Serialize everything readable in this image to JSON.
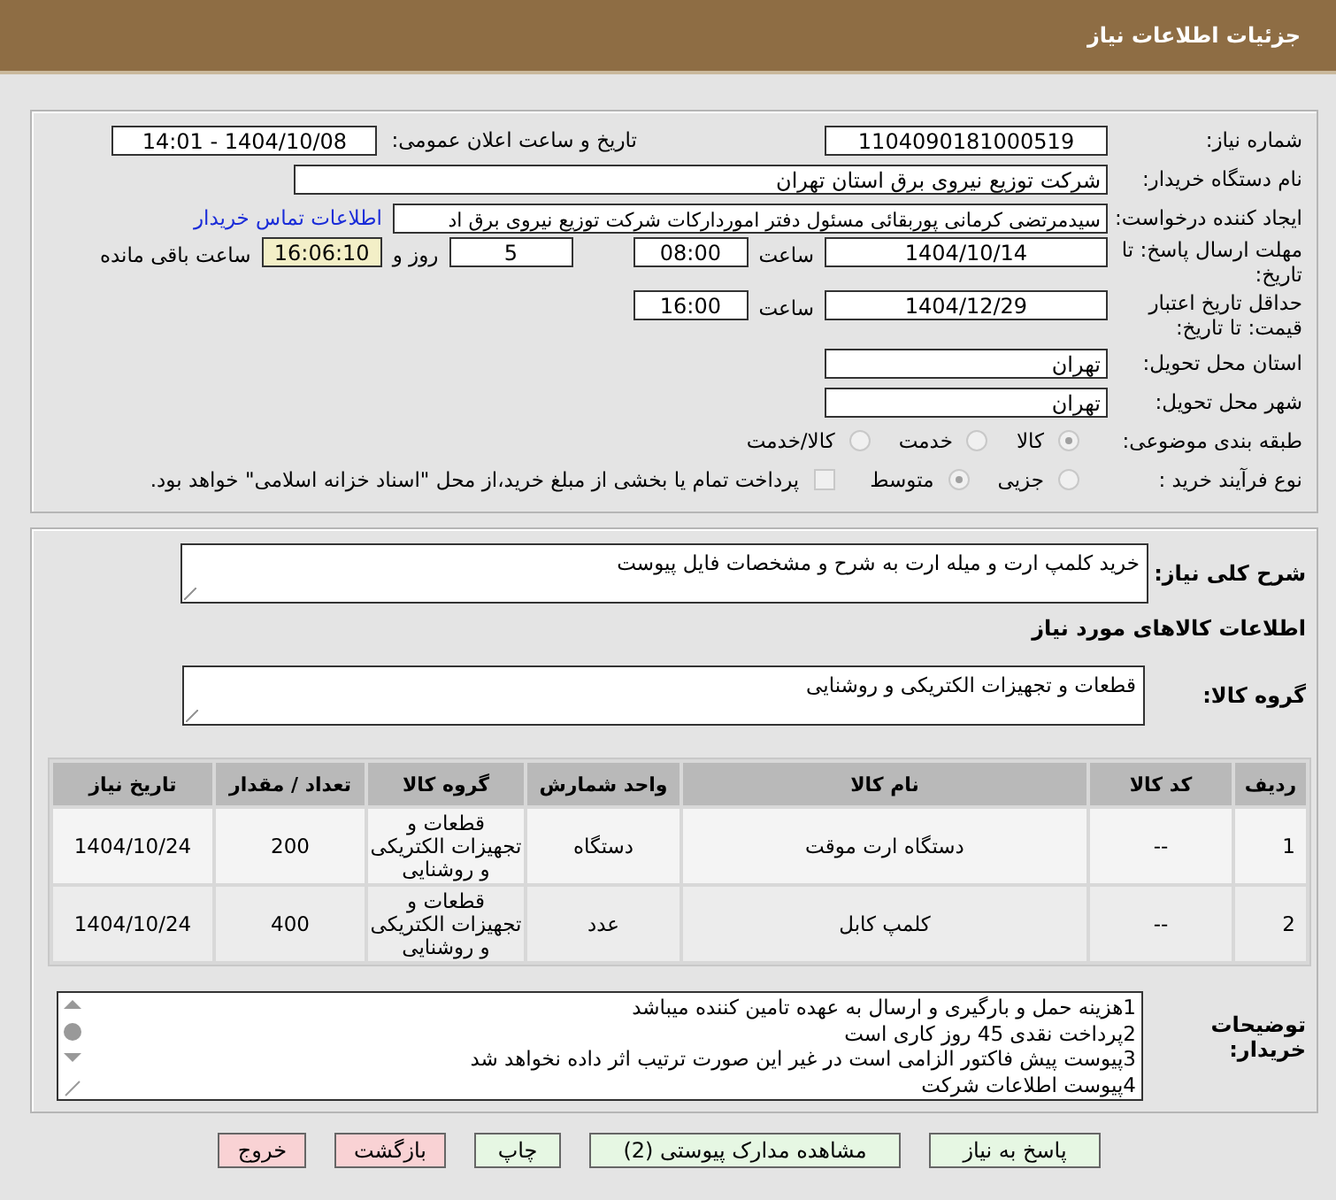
{
  "header": {
    "title": "جزئیات اطلاعات نیاز"
  },
  "need_number": {
    "label": "شماره نیاز:",
    "value": "1104090181000519"
  },
  "announce": {
    "label": "تاریخ و ساعت اعلان عمومی:",
    "value": "1404/10/08 - 14:01"
  },
  "buyer_org": {
    "label": "نام دستگاه خریدار:",
    "value": "شرکت توزیع نیروی برق استان تهران"
  },
  "requester": {
    "label": "ایجاد کننده درخواست:",
    "value": "سیدمرتضی کرمانی پوربقائی مسئول دفتر اموردارکات شرکت توزیع نیروی برق اد",
    "link": "اطلاعات تماس خریدار"
  },
  "deadline": {
    "label": "مهلت ارسال پاسخ: تا تاریخ:",
    "date": "1404/10/14",
    "time_label": "ساعت",
    "time": "08:00",
    "days": "5",
    "days_label": "روز و",
    "remaining": "16:06:10",
    "remaining_label": "ساعت باقی مانده"
  },
  "validity": {
    "label": "حداقل تاریخ اعتبار قیمت: تا تاریخ:",
    "date": "1404/12/29",
    "time_label": "ساعت",
    "time": "16:00"
  },
  "province": {
    "label": "استان محل تحویل:",
    "value": "تهران"
  },
  "city": {
    "label": "شهر محل تحویل:",
    "value": "تهران"
  },
  "category": {
    "label": "طبقه بندی موضوعی:",
    "options": [
      {
        "label": "کالا",
        "selected": true
      },
      {
        "label": "خدمت",
        "selected": false
      },
      {
        "label": "کالا/خدمت",
        "selected": false
      }
    ]
  },
  "process": {
    "label": "نوع فرآیند خرید :",
    "options": [
      {
        "label": "جزیی",
        "selected": false
      },
      {
        "label": "متوسط",
        "selected": true
      }
    ],
    "payment": {
      "checked": false,
      "text": "پرداخت تمام یا بخشی از مبلغ خرید،از محل \"اسناد خزانه اسلامی\" خواهد بود."
    }
  },
  "description": {
    "label": "شرح کلی نیاز:",
    "value": "خرید کلمپ ارت و میله ارت به شرح و مشخصات فایل پیوست"
  },
  "goods_title": "اطلاعات کالاهای مورد نیاز",
  "goods_group": {
    "label": "گروه کالا:",
    "value": "قطعات و تجهیزات الکتریکی و روشنایی"
  },
  "table": {
    "columns": [
      "ردیف",
      "کد کالا",
      "نام کالا",
      "واحد شمارش",
      "گروه کالا",
      "تعداد / مقدار",
      "تاریخ نیاز"
    ],
    "rows": [
      [
        "1",
        "--",
        "دستگاه ارت موقت",
        "دستگاه",
        "قطعات و تجهیزات الکتریکی و روشنایی",
        "200",
        "1404/10/24"
      ],
      [
        "2",
        "--",
        "کلمپ کابل",
        "عدد",
        "قطعات و تجهیزات الکتریکی و روشنایی",
        "400",
        "1404/10/24"
      ]
    ]
  },
  "buyer_notes": {
    "label": "توضیحات خریدار:",
    "lines": [
      "1هزینه حمل و بارگیری و ارسال به عهده تامین کننده میباشد",
      "2پرداخت نقدی 45 روز کاری است",
      "3پیوست پیش فاکتور الزامی است در غیر این صورت ترتیب اثر داده نخواهد شد",
      "4پیوست اطلاعات شرکت"
    ]
  },
  "buttons": [
    {
      "label": "پاسخ به نیاز",
      "kind": "action"
    },
    {
      "label": "مشاهده مدارک پیوستی (2)",
      "kind": "action"
    },
    {
      "label": "چاپ",
      "kind": "action"
    },
    {
      "label": "بازگشت",
      "kind": "exit"
    },
    {
      "label": "خروج",
      "kind": "exit"
    }
  ]
}
